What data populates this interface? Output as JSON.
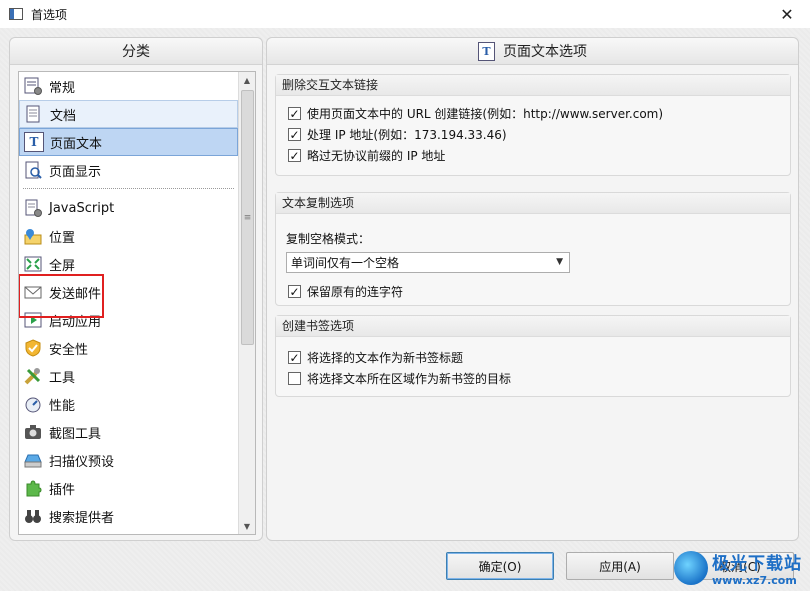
{
  "window": {
    "title": "首选项",
    "close_glyph": "✕"
  },
  "left_panel": {
    "header": "分类",
    "items": [
      {
        "label": "常规",
        "icon": "general-settings-icon"
      },
      {
        "label": "文档",
        "icon": "document-icon"
      },
      {
        "label": "页面文本",
        "icon": "page-text-icon",
        "glyph": "T"
      },
      {
        "label": "页面显示",
        "icon": "page-display-icon"
      },
      {
        "label": "JavaScript",
        "icon": "javascript-icon"
      },
      {
        "label": "位置",
        "icon": "location-pin-icon"
      },
      {
        "label": "全屏",
        "icon": "fullscreen-icon"
      },
      {
        "label": "发送邮件",
        "icon": "email-icon"
      },
      {
        "label": "启动应用",
        "icon": "launch-app-icon"
      },
      {
        "label": "安全性",
        "icon": "security-shield-icon"
      },
      {
        "label": "工具",
        "icon": "tools-icon"
      },
      {
        "label": "性能",
        "icon": "performance-gauge-icon"
      },
      {
        "label": "截图工具",
        "icon": "screenshot-camera-icon"
      },
      {
        "label": "扫描仪预设",
        "icon": "scanner-icon"
      },
      {
        "label": "插件",
        "icon": "plugin-puzzle-icon"
      },
      {
        "label": "搜索提供者",
        "icon": "search-binoculars-icon"
      }
    ],
    "selected": "页面文本"
  },
  "right_panel": {
    "header": "页面文本选项",
    "header_icon_glyph": "T",
    "section1": {
      "title": "删除交互文本链接",
      "options": [
        {
          "label": "使用页面文本中的 URL 创建链接(例如：http://www.server.com)",
          "checked": true
        },
        {
          "label": "处理 IP 地址(例如：173.194.33.46)",
          "checked": true
        },
        {
          "label": "略过无协议前缀的 IP 地址",
          "checked": true
        }
      ]
    },
    "section2": {
      "title": "文本复制选项",
      "mode_label": "复制空格模式：",
      "mode_value": "单词间仅有一个空格",
      "keep_hyphen": {
        "label": "保留原有的连字符",
        "checked": true
      }
    },
    "section3": {
      "title": "创建书签选项",
      "options": [
        {
          "label": "将选择的文本作为新书签标题",
          "checked": true
        },
        {
          "label": "将选择文本所在区域作为新书签的目标",
          "checked": false
        }
      ]
    }
  },
  "buttons": {
    "ok": "确定(O)",
    "apply": "应用(A)",
    "cancel": "取消(C)"
  },
  "watermark": {
    "name": "极光下载站",
    "url": "www.xz7.com"
  },
  "check_glyph": "✓",
  "colors": {
    "selected_bg": "#bed6f3",
    "highlight_box": "#e02020"
  }
}
